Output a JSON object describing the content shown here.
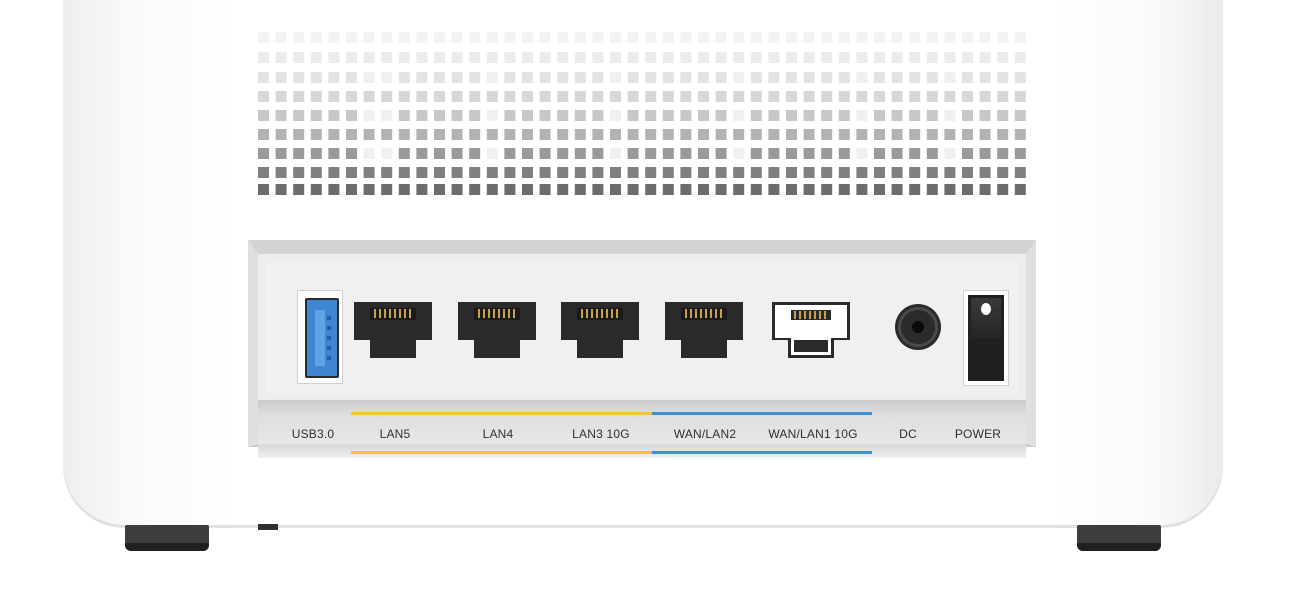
{
  "image": {
    "subject": "router-rear-panel",
    "colors": {
      "body": "#ffffff",
      "panel": "#ededee",
      "lan_accent": "#f4c531",
      "wan_accent": "#3f8fd6",
      "usb_port": "#3e86d2",
      "port_dark": "#2a2a2c"
    }
  },
  "ports": {
    "usb": {
      "label": "USB3.0",
      "icon": "usb-port-icon"
    },
    "lan5": {
      "label": "LAN5",
      "icon": "ethernet-port-icon"
    },
    "lan4": {
      "label": "LAN4",
      "icon": "ethernet-port-icon"
    },
    "lan3": {
      "label": "LAN3 10G",
      "icon": "ethernet-port-icon"
    },
    "wan_lan2": {
      "label": "WAN/LAN2",
      "icon": "ethernet-port-icon"
    },
    "wan_lan1": {
      "label": "WAN/LAN1 10G",
      "icon": "ethernet-port-icon"
    },
    "dc": {
      "label": "DC",
      "icon": "dc-jack-icon"
    },
    "power": {
      "label": "POWER",
      "icon": "power-switch-icon"
    }
  }
}
